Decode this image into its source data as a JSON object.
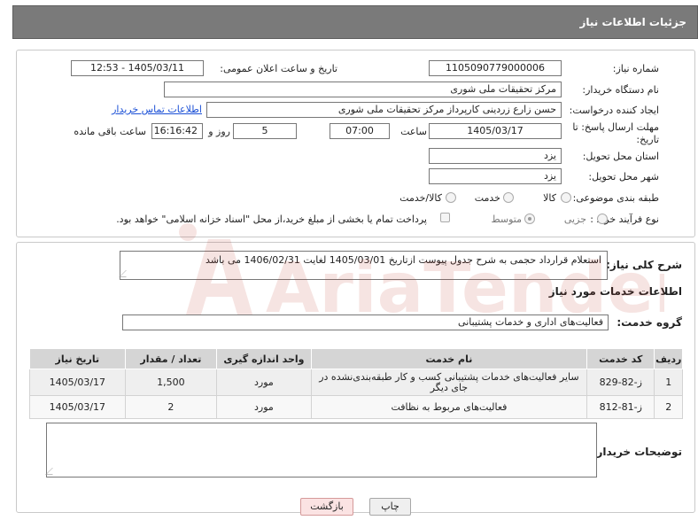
{
  "header": {
    "title": "جزئیات اطلاعات نیاز"
  },
  "form": {
    "need_number_label": "شماره نیاز:",
    "need_number": "1105090779000006",
    "announce_label": "تاریخ و ساعت اعلان عمومی:",
    "announce_value": "1405/03/11 - 12:53",
    "buyer_org_label": "نام دستگاه خریدار:",
    "buyer_org": "مرکز تحقیقات ملی شوری",
    "creator_label": "ایجاد کننده درخواست:",
    "creator": "حسن زارع زردینی کارپرداز مرکز تحقیقات ملی شوری",
    "contact_link": "اطلاعات تماس خریدار",
    "deadline_label_1": "مهلت ارسال پاسخ: تا",
    "deadline_label_2": "تاریخ:",
    "deadline_date": "1405/03/17",
    "time_label": "ساعت",
    "deadline_time": "07:00",
    "days": "5",
    "days_label": "روز و",
    "remaining_time": "16:16:42",
    "remaining_label": "ساعت باقی مانده",
    "province_label": "استان محل تحویل:",
    "province": "یزد",
    "city_label": "شهر محل تحویل:",
    "city": "یزد",
    "category_label": "طبقه بندی موضوعی:",
    "category_options": [
      "کالا",
      "خدمت",
      "کالا/خدمت"
    ],
    "process_label": "نوع فرآیند خرید :",
    "process_options": [
      "جزیی",
      "متوسط"
    ],
    "payment_note": "پرداخت تمام یا بخشی از مبلغ خرید،از محل \"اسناد خزانه اسلامی\" خواهد بود."
  },
  "summary": {
    "label": "شرح کلی نیاز:",
    "text": "استعلام قرارداد حجمی به شرح جدول پیوست ازتاریخ 1405/03/01 لغایت 1406/02/31 می باشد"
  },
  "services": {
    "section_title": "اطلاعات خدمات مورد نیاز",
    "group_label": "گروه خدمت:",
    "group_value": "فعالیت‌های اداری و خدمات پشتیبانی",
    "columns": [
      "ردیف",
      "کد خدمت",
      "نام خدمت",
      "واحد اندازه گیری",
      "تعداد / مقدار",
      "تاریخ نیاز"
    ],
    "rows": [
      {
        "row": "1",
        "code": "ز-82-829",
        "name": "سایر فعالیت‌های خدمات پشتیبانی کسب و کار طبقه‌بندی‌نشده در جای دیگر",
        "unit": "مورد",
        "qty": "1,500",
        "date": "1405/03/17"
      },
      {
        "row": "2",
        "code": "ز-81-812",
        "name": "فعالیت‌های مربوط به نظافت",
        "unit": "مورد",
        "qty": "2",
        "date": "1405/03/17"
      }
    ]
  },
  "buyer_notes": {
    "label": "توضیحات خریدار:",
    "text": ""
  },
  "buttons": {
    "print": "چاپ",
    "back": "بازگشت"
  },
  "watermark": {
    "text": "AriaTender.neT"
  }
}
